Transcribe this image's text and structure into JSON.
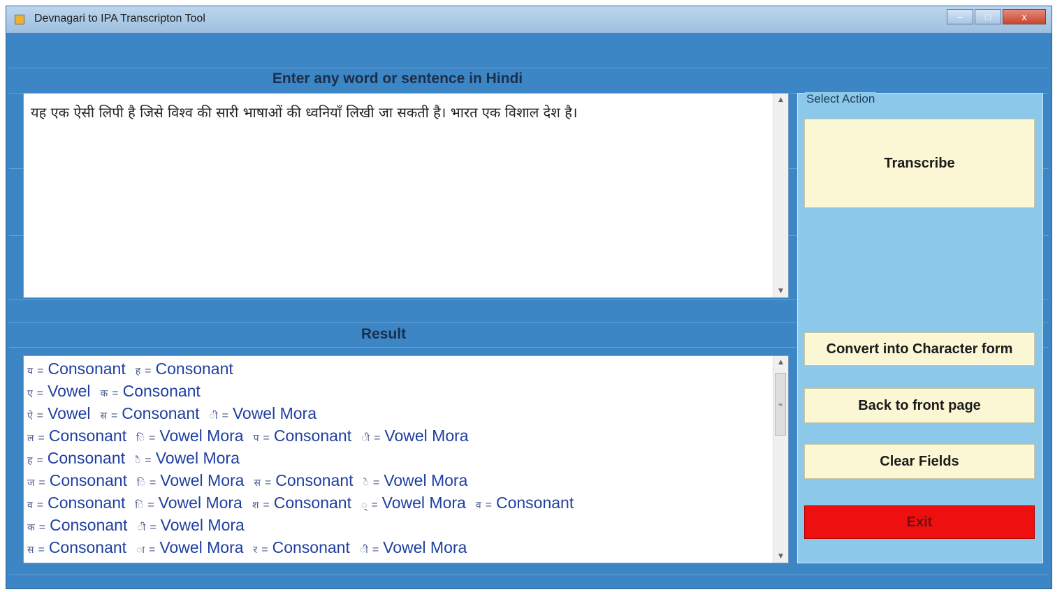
{
  "window": {
    "title": "Devnagari to IPA Transcripton Tool",
    "controls": [
      "–",
      "□",
      "x"
    ]
  },
  "input": {
    "label": "Enter any word or sentence in Hindi",
    "text": "यह एक ऐसी लिपी है जिसे विश्व की सारी भाषाओं की ध्वनियाँ लिखी जा सकती है। भारत एक विशाल देश है।"
  },
  "result": {
    "label": "Result",
    "lines": [
      [
        {
          "d": "य",
          "t": "Consonant"
        },
        {
          "d": "ह",
          "t": "Consonant"
        }
      ],
      [
        {
          "d": "ए",
          "t": "Vowel"
        },
        {
          "d": "क",
          "t": "Consonant"
        }
      ],
      [
        {
          "d": "ऐ",
          "t": "Vowel"
        },
        {
          "d": "स",
          "t": "Consonant"
        },
        {
          "d": "ी",
          "t": "Vowel Mora"
        }
      ],
      [
        {
          "d": "ल",
          "t": "Consonant"
        },
        {
          "d": "ि",
          "t": "Vowel Mora"
        },
        {
          "d": "प",
          "t": "Consonant"
        },
        {
          "d": "ी",
          "t": "Vowel Mora"
        }
      ],
      [
        {
          "d": "ह",
          "t": "Consonant"
        },
        {
          "d": "ै",
          "t": "Vowel Mora"
        }
      ],
      [
        {
          "d": "ज",
          "t": "Consonant"
        },
        {
          "d": "ि",
          "t": "Vowel Mora"
        },
        {
          "d": "स",
          "t": "Consonant"
        },
        {
          "d": "े",
          "t": "Vowel Mora"
        }
      ],
      [
        {
          "d": "व",
          "t": "Consonant"
        },
        {
          "d": "ि",
          "t": "Vowel Mora"
        },
        {
          "d": "श",
          "t": "Consonant"
        },
        {
          "d": "्",
          "t": "Vowel Mora"
        },
        {
          "d": "व",
          "t": "Consonant"
        }
      ],
      [
        {
          "d": "क",
          "t": "Consonant"
        },
        {
          "d": "ी",
          "t": "Vowel Mora"
        }
      ],
      [
        {
          "d": "स",
          "t": "Consonant"
        },
        {
          "d": "ा",
          "t": "Vowel Mora"
        },
        {
          "d": "र",
          "t": "Consonant"
        },
        {
          "d": "ी",
          "t": "Vowel Mora"
        }
      ]
    ]
  },
  "actions": {
    "group_title": "Select Action",
    "transcribe": "Transcribe",
    "convert": "Convert into Character form",
    "back": "Back to front page",
    "clear": "Clear Fields",
    "exit": "Exit"
  },
  "colors": {
    "window_bg": "#3d86c6",
    "panel_bg": "#8cc8ea",
    "button_bg": "#fbf6d4",
    "exit_bg": "#ee1010",
    "result_text": "#1e3fa0"
  }
}
